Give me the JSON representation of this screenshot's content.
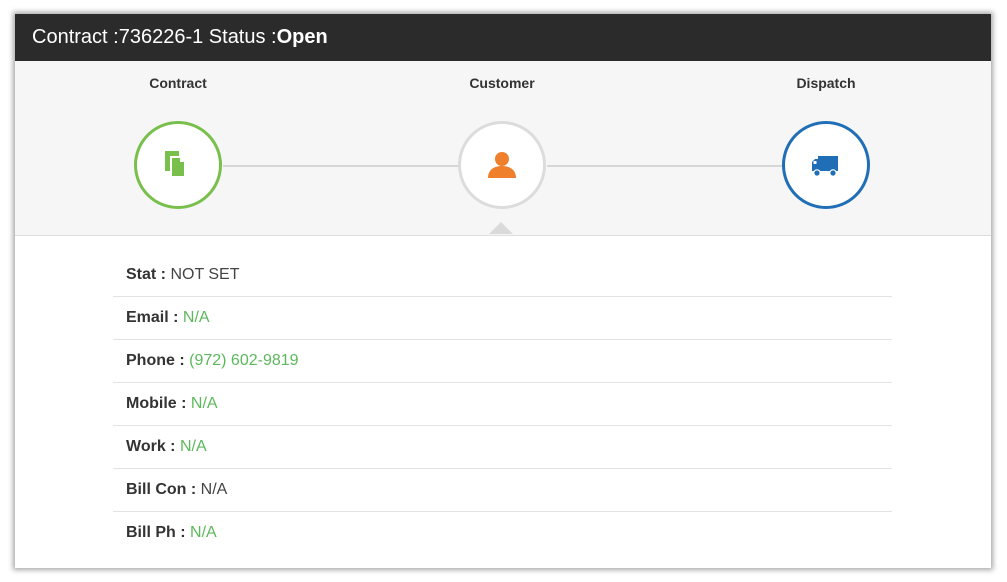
{
  "header": {
    "contract_prefix": "Contract :",
    "contract_number": "736226-1",
    "status_prefix": " Status :",
    "status_value": "Open"
  },
  "steps": [
    {
      "label": "Contract",
      "icon": "document-icon",
      "color": "#79bf4b"
    },
    {
      "label": "Customer",
      "icon": "person-icon",
      "color": "#f07f2b"
    },
    {
      "label": "Dispatch",
      "icon": "truck-icon",
      "color": "#1f6eb6"
    }
  ],
  "details": [
    {
      "label": "Stat :",
      "value": "NOT SET",
      "link": false
    },
    {
      "label": "Email :",
      "value": "N/A",
      "link": true
    },
    {
      "label": "Phone :",
      "value": "(972) 602-9819",
      "link": true
    },
    {
      "label": "Mobile :",
      "value": "N/A",
      "link": true
    },
    {
      "label": "Work :",
      "value": "N/A",
      "link": true
    },
    {
      "label": "Bill Con :",
      "value": "N/A",
      "link": false
    },
    {
      "label": "Bill Ph :",
      "value": "N/A",
      "link": true
    }
  ]
}
